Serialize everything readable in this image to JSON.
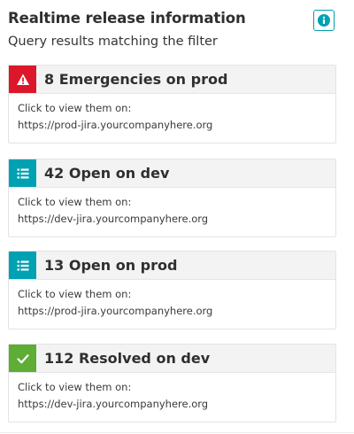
{
  "header": {
    "title": "Realtime release information",
    "subtitle": "Query results matching the filter",
    "info_button": {
      "icon": "info-icon",
      "color": "#00a1b2"
    }
  },
  "cards": [
    {
      "title": "8 Emergencies on prod",
      "icon": "warning-icon",
      "badge_color": "#dc172a",
      "line1": "Click to view them on:",
      "link": "https://prod-jira.yourcompanyhere.org"
    },
    {
      "title": "42 Open on dev",
      "icon": "list-icon",
      "badge_color": "#00a1b2",
      "line1": "Click to view them on:",
      "link": "https://dev-jira.yourcompanyhere.org"
    },
    {
      "title": "13 Open on prod",
      "icon": "list-icon",
      "badge_color": "#00a1b2",
      "line1": "Click to view them on:",
      "link": "https://prod-jira.yourcompanyhere.org"
    },
    {
      "title": "112 Resolved on dev",
      "icon": "check-icon",
      "badge_color": "#5ead35",
      "line1": "Click to view them on:",
      "link": "https://dev-jira.yourcompanyhere.org"
    }
  ]
}
